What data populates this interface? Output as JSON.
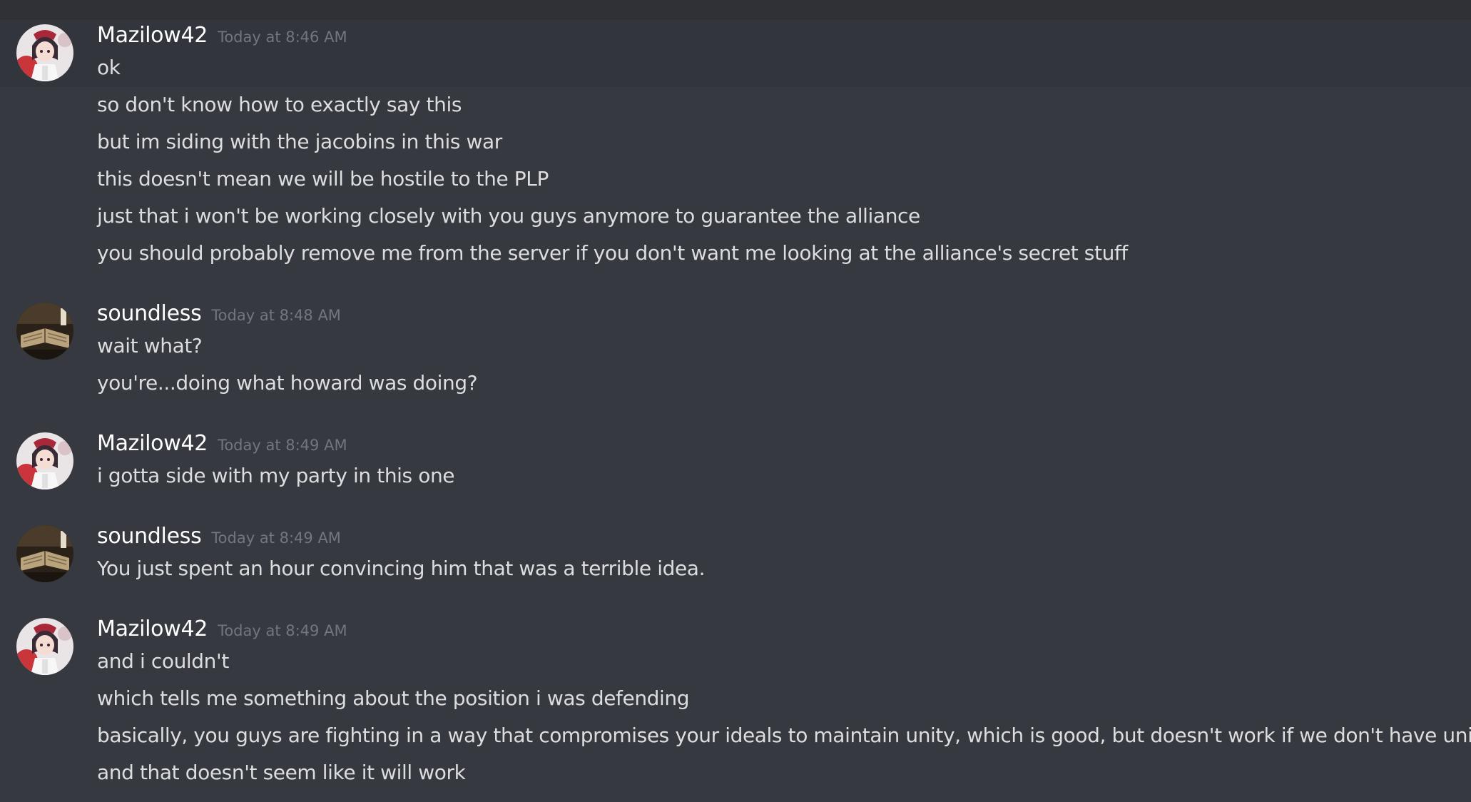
{
  "colors": {
    "background": "#36393f",
    "username": "#ffffff",
    "timestamp": "#72767d",
    "message_text": "#dcddde"
  },
  "messages": [
    {
      "author": "Mazilow42",
      "timestamp": "Today at 8:46 AM",
      "avatar": "anime-girl-avatar",
      "lines": [
        "ok",
        "so don't know how to exactly say this",
        "but im siding with the jacobins in this war",
        "this doesn't mean we will be hostile to the PLP",
        "just that i won't be working closely with you guys anymore to guarantee the alliance",
        "you should probably remove me from the server if you don't want me looking at the alliance's secret stuff"
      ]
    },
    {
      "author": "soundless",
      "timestamp": "Today at 8:48 AM",
      "avatar": "old-book-avatar",
      "lines": [
        "wait what?",
        "you're...doing what howard was doing?"
      ]
    },
    {
      "author": "Mazilow42",
      "timestamp": "Today at 8:49 AM",
      "avatar": "anime-girl-avatar",
      "lines": [
        "i gotta side with my party in this one"
      ]
    },
    {
      "author": "soundless",
      "timestamp": "Today at 8:49 AM",
      "avatar": "old-book-avatar",
      "lines": [
        "You just spent an hour convincing him that was a terrible idea."
      ]
    },
    {
      "author": "Mazilow42",
      "timestamp": "Today at 8:49 AM",
      "avatar": "anime-girl-avatar",
      "lines": [
        "and i couldn't",
        "which tells me something about the position i was defending",
        "basically, you guys are fighting in a way that compromises your ideals to maintain unity, which is good, but doesn't work if we don't have unity",
        "and that doesn't seem like it will work"
      ]
    }
  ]
}
